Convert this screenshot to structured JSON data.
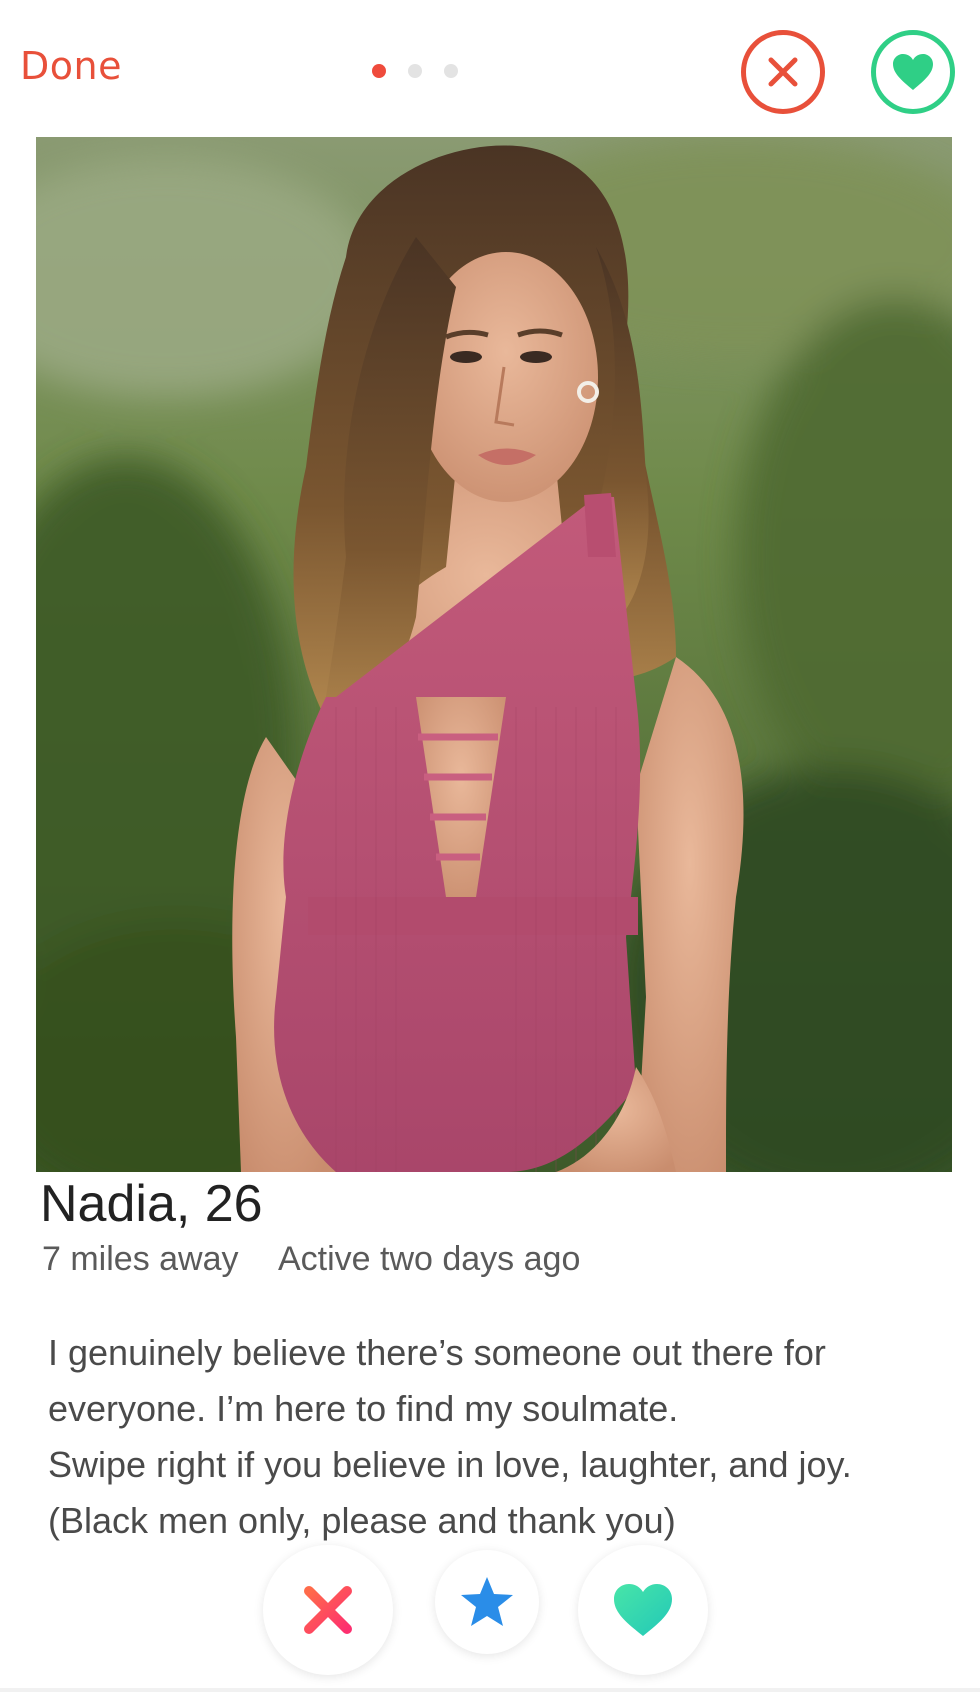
{
  "header": {
    "done_label": "Done",
    "photo_indicator": {
      "total": 3,
      "active_index": 0
    }
  },
  "colors": {
    "accent_red": "#e8503a",
    "accent_green": "#2fcf86",
    "star_blue": "#2a8de8",
    "heart_teal": "#3ddcb0"
  },
  "icons": {
    "top_close": "close-circle-icon",
    "top_like": "heart-circle-icon",
    "nope": "x-icon",
    "super_like": "star-icon",
    "like": "heart-icon"
  },
  "profile": {
    "name_age": "Nadia, 26",
    "distance": "7 miles away",
    "activity": "Active two days ago",
    "bio_lines": [
      "I genuinely believe there’s someone out there for",
      "everyone. I’m here to find my soulmate.",
      "Swipe right if you believe in love, laughter, and joy.",
      "(Black men only, please and thank you)"
    ]
  }
}
